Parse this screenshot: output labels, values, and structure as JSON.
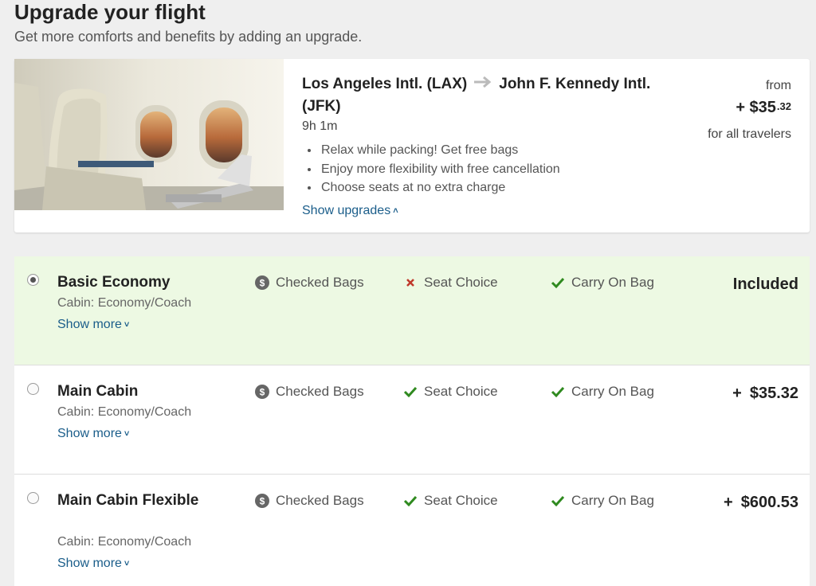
{
  "header": {
    "title": "Upgrade your flight",
    "subtitle": "Get more comforts and benefits by adding an upgrade."
  },
  "summary": {
    "origin": "Los Angeles Intl. (LAX)",
    "destination": "John F. Kennedy Intl. (JFK)",
    "duration": "9h 1m",
    "benefits": [
      "Relax while packing! Get free bags",
      "Enjoy more flexibility with free cancellation",
      "Choose seats at no extra charge"
    ],
    "show_upgrades_label": "Show upgrades",
    "from_label": "from",
    "price_prefix": "+ $35",
    "price_cents": ".32",
    "price_note": "for all travelers"
  },
  "fares": [
    {
      "name": "Basic Economy",
      "cabin": "Cabin: Economy/Coach",
      "show_more": "Show more",
      "selected": true,
      "features": [
        {
          "label": "Checked Bags",
          "status": "paid",
          "icon": "dollar-icon"
        },
        {
          "label": "Seat Choice",
          "status": "not-included",
          "icon": "x-icon"
        },
        {
          "label": "Carry On Bag",
          "status": "included",
          "icon": "check-icon"
        }
      ],
      "price_plus": "",
      "price": "Included"
    },
    {
      "name": "Main Cabin",
      "cabin": "Cabin: Economy/Coach",
      "show_more": "Show more",
      "selected": false,
      "features": [
        {
          "label": "Checked Bags",
          "status": "paid",
          "icon": "dollar-icon"
        },
        {
          "label": "Seat Choice",
          "status": "included",
          "icon": "check-icon"
        },
        {
          "label": "Carry On Bag",
          "status": "included",
          "icon": "check-icon"
        }
      ],
      "price_plus": "+",
      "price": "$35.32"
    },
    {
      "name": "Main Cabin Flexible",
      "cabin": "Cabin: Economy/Coach",
      "show_more": "Show more",
      "selected": false,
      "features": [
        {
          "label": "Checked Bags",
          "status": "paid",
          "icon": "dollar-icon"
        },
        {
          "label": "Seat Choice",
          "status": "included",
          "icon": "check-icon"
        },
        {
          "label": "Carry On Bag",
          "status": "included",
          "icon": "check-icon"
        }
      ],
      "price_plus": "+",
      "price": "$600.53"
    }
  ],
  "colors": {
    "selected_bg": "#edf9e3",
    "link": "#1a5d8a",
    "check": "#2f8a1f",
    "cross": "#c0392b",
    "dollar": "#666666"
  }
}
